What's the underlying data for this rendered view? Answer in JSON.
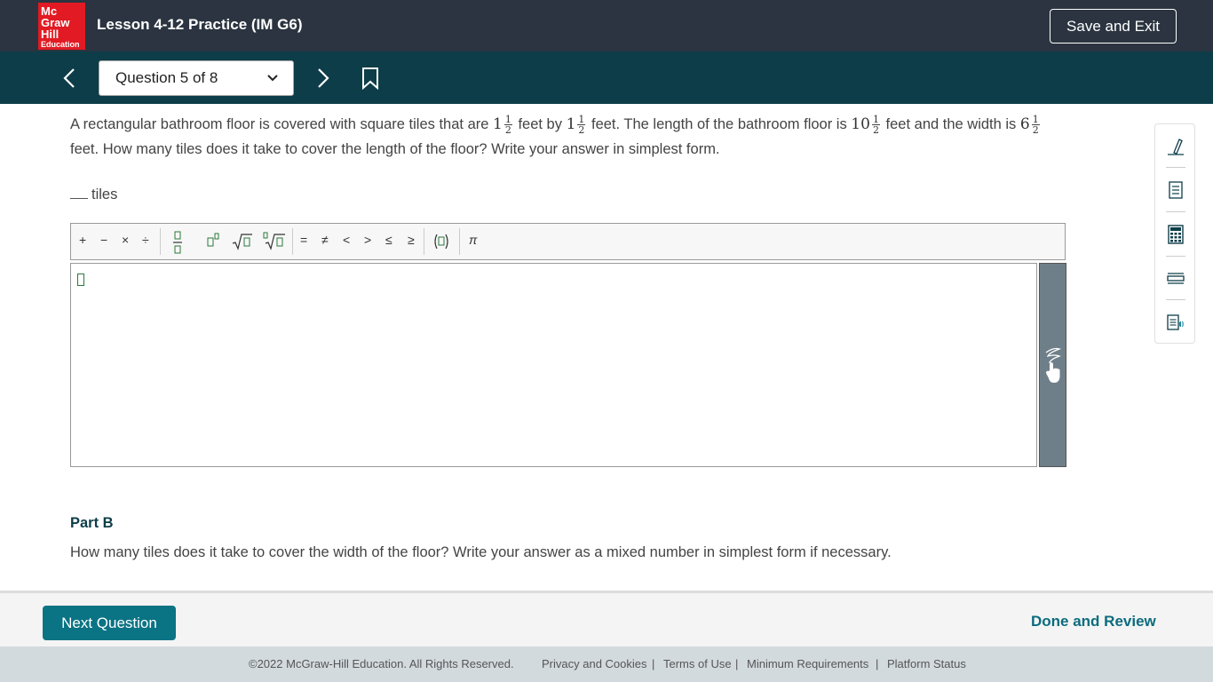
{
  "header": {
    "logo_lines": [
      "Mc",
      "Graw",
      "Hill",
      "Education"
    ],
    "lesson_title": "Lesson 4-12 Practice (IM G6)",
    "save_exit_label": "Save and Exit"
  },
  "nav": {
    "question_selector": "Question 5 of 8"
  },
  "question": {
    "part1": "A rectangular bathroom floor is covered with square tiles that are",
    "part2": "feet by",
    "part3": "feet. The length of the bathroom floor is",
    "part4": "feet and the width is",
    "part5": "feet. How many tiles does it take to cover the length of the floor? Write your answer in simplest form.",
    "values": [
      {
        "whole": "1",
        "num": "1",
        "den": "2"
      },
      {
        "whole": "1",
        "num": "1",
        "den": "2"
      },
      {
        "whole": "10",
        "num": "1",
        "den": "2"
      },
      {
        "whole": "6",
        "num": "1",
        "den": "2"
      }
    ],
    "answer_unit": "tiles"
  },
  "math_toolbar": {
    "plus": "+",
    "minus": "−",
    "times": "×",
    "divide": "÷",
    "equals": "=",
    "not_equal": "≠",
    "less": "<",
    "greater": ">",
    "less_equal": "≤",
    "greater_equal": "≥",
    "pi": "π"
  },
  "part_b": {
    "heading": "Part B",
    "question": "How many tiles does it take to cover the width of the floor? Write your answer as a mixed number in simplest form if necessary."
  },
  "footer": {
    "next_question_label": "Next Question",
    "done_review_label": "Done and Review",
    "copyright": "©2022 McGraw-Hill Education. All Rights Reserved.",
    "links": [
      "Privacy and Cookies",
      "Terms of Use",
      "Minimum Requirements",
      "Platform Status"
    ],
    "separator": "|"
  },
  "colors": {
    "topbar": "#2b3440",
    "navbar": "#0d3d48",
    "accent": "#0a7384",
    "logo": "#e21a23"
  }
}
